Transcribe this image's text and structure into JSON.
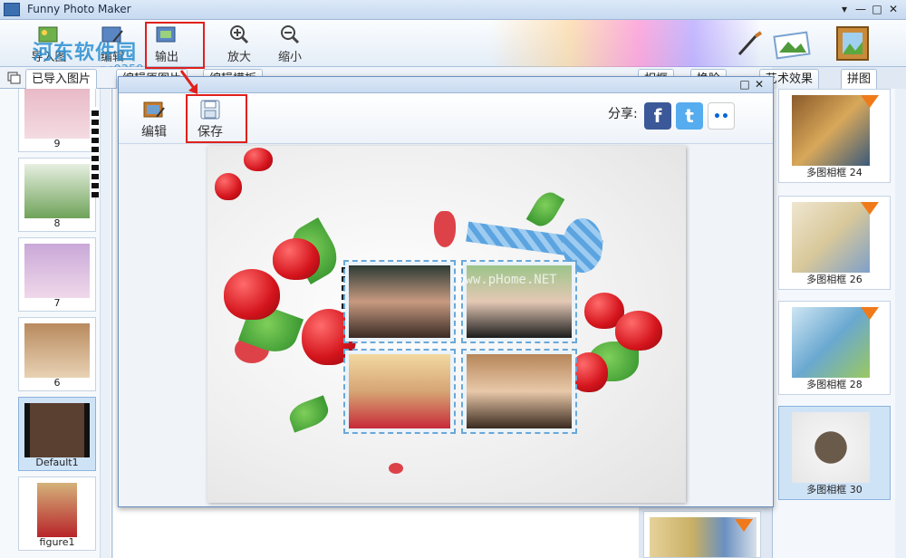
{
  "window": {
    "title": "Funny Photo Maker",
    "controls": [
      "▾",
      "—",
      "□",
      "✕"
    ]
  },
  "toolbar": {
    "import_label": "导入图片",
    "edit_label": "编辑",
    "output_label": "输出",
    "zoom_in_label": "放大",
    "zoom_out_label": "缩小"
  },
  "watermark": {
    "text": "河东软件园",
    "sub": "pc0359"
  },
  "left_tabs": [
    "已导入图片",
    "编辑原图片",
    "编辑模板"
  ],
  "right_tabs": [
    "相框",
    "换脸",
    "艺术效果",
    "拼图"
  ],
  "imported_photos": [
    {
      "label": "9"
    },
    {
      "label": "8"
    },
    {
      "label": "7"
    },
    {
      "label": "6"
    },
    {
      "label": "Default1"
    },
    {
      "label": "figure1"
    }
  ],
  "templates": [
    {
      "label": "多图相框 24"
    },
    {
      "label": "多图相框 26"
    },
    {
      "label": "多图相框 28"
    },
    {
      "label": "多图相框 30"
    }
  ],
  "dialog": {
    "controls": [
      "□",
      "✕"
    ],
    "edit_label": "编辑",
    "save_label": "保存",
    "share_label": "分享:",
    "social": [
      {
        "name": "facebook",
        "glyph": "f",
        "color": "#3b5998"
      },
      {
        "name": "twitter",
        "glyph": "t",
        "color": "#55acee"
      },
      {
        "name": "flickr",
        "glyph": "••",
        "color": "#ffffff"
      }
    ],
    "canvas_watermark": "www.pHome.NET"
  },
  "colors": {
    "highlight": "#e0201c",
    "accent": "#2a8fd0",
    "download": "#f07a1a"
  }
}
